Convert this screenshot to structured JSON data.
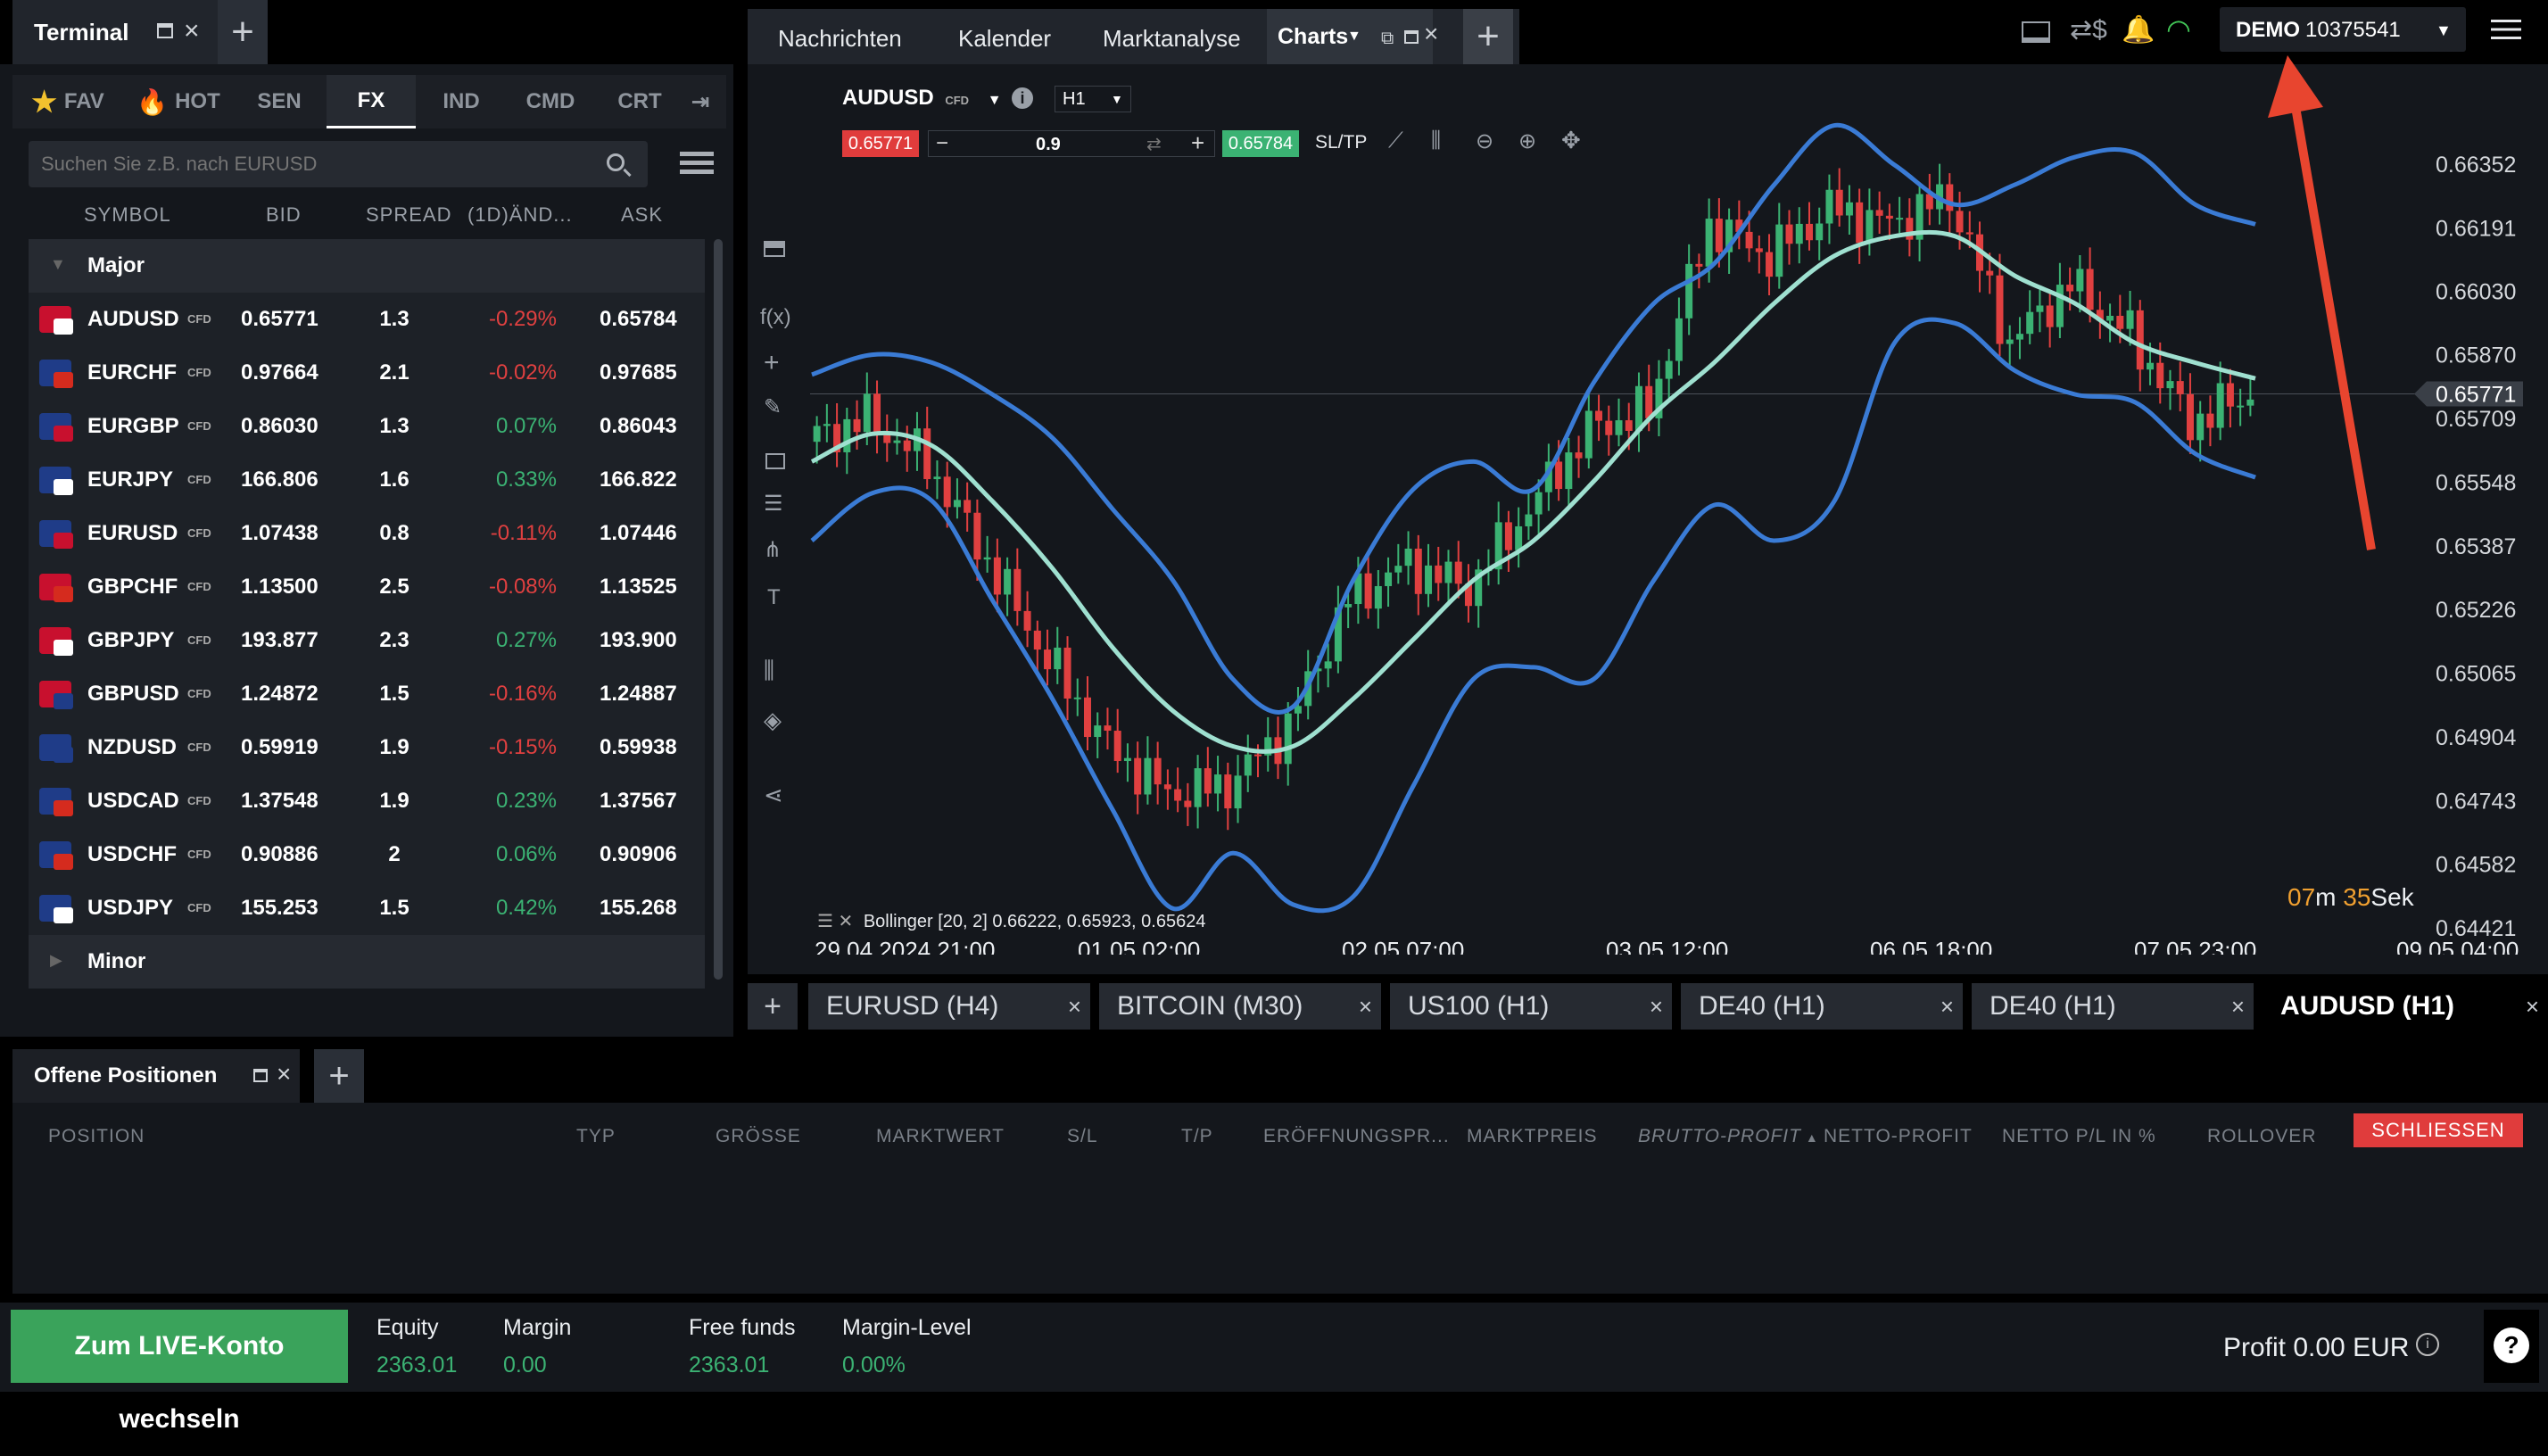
{
  "terminal": {
    "title": "Terminal",
    "search_placeholder": "Suchen Sie z.B. nach EURUSD",
    "categories": [
      "FAV",
      "HOT",
      "SEN",
      "FX",
      "IND",
      "CMD",
      "CRT"
    ],
    "columns": [
      "SYMBOL",
      "BID",
      "SPREAD",
      "(1D)ÄND...",
      "ASK"
    ],
    "group_major": "Major",
    "group_minor": "Minor",
    "cfd": "CFD",
    "rows": [
      {
        "symbol": "AUDUSD",
        "bid": "0.65771",
        "spread": "1.3",
        "change": "-0.29%",
        "ask": "0.65784"
      },
      {
        "symbol": "EURCHF",
        "bid": "0.97664",
        "spread": "2.1",
        "change": "-0.02%",
        "ask": "0.97685"
      },
      {
        "symbol": "EURGBP",
        "bid": "0.86030",
        "spread": "1.3",
        "change": "0.07%",
        "ask": "0.86043"
      },
      {
        "symbol": "EURJPY",
        "bid": "166.806",
        "spread": "1.6",
        "change": "0.33%",
        "ask": "166.822"
      },
      {
        "symbol": "EURUSD",
        "bid": "1.07438",
        "spread": "0.8",
        "change": "-0.11%",
        "ask": "1.07446"
      },
      {
        "symbol": "GBPCHF",
        "bid": "1.13500",
        "spread": "2.5",
        "change": "-0.08%",
        "ask": "1.13525"
      },
      {
        "symbol": "GBPJPY",
        "bid": "193.877",
        "spread": "2.3",
        "change": "0.27%",
        "ask": "193.900"
      },
      {
        "symbol": "GBPUSD",
        "bid": "1.24872",
        "spread": "1.5",
        "change": "-0.16%",
        "ask": "1.24887"
      },
      {
        "symbol": "NZDUSD",
        "bid": "0.59919",
        "spread": "1.9",
        "change": "-0.15%",
        "ask": "0.59938"
      },
      {
        "symbol": "USDCAD",
        "bid": "1.37548",
        "spread": "1.9",
        "change": "0.23%",
        "ask": "1.37567"
      },
      {
        "symbol": "USDCHF",
        "bid": "0.90886",
        "spread": "2",
        "change": "0.06%",
        "ask": "0.90906"
      },
      {
        "symbol": "USDJPY",
        "bid": "155.253",
        "spread": "1.5",
        "change": "0.42%",
        "ask": "155.268"
      }
    ]
  },
  "topnav": {
    "tabs": [
      "Nachrichten",
      "Kalender",
      "Marktanalyse",
      "Charts"
    ],
    "account_mode": "DEMO",
    "account_number": "10375541"
  },
  "chart": {
    "symbol": "AUDUSD",
    "cfd": "CFD",
    "timeframe": "H1",
    "bid": "0.65771",
    "ask": "0.65784",
    "volume": "0.9",
    "sltp": "SL/TP",
    "indicator": "Bollinger [20, 2] 0.66222, 0.65923, 0.65624",
    "countdown_min": "07",
    "countdown_min_unit": "m",
    "countdown_sec": "35",
    "countdown_sec_unit": "Sek"
  },
  "chart_data": {
    "type": "line",
    "title": "AUDUSD H1",
    "y_ticks": [
      "0.66352",
      "0.66191",
      "0.66030",
      "0.65870",
      "0.65709",
      "0.65548",
      "0.65387",
      "0.65226",
      "0.65065",
      "0.64904",
      "0.64743",
      "0.64582",
      "0.64421"
    ],
    "ylim": [
      0.64421,
      0.66352
    ],
    "current_price": "0.65771",
    "x_ticks": [
      "29.04.2024 21:00",
      "01.05 02:00",
      "02.05 07:00",
      "03.05 12:00",
      "06.05 18:00",
      "07.05 23:00",
      "09.05 04:00"
    ],
    "series": [
      {
        "name": "Bollinger upper",
        "values": [
          0.6582,
          0.6587,
          0.6585,
          0.6577,
          0.6566,
          0.6548,
          0.653,
          0.6505,
          0.6498,
          0.653,
          0.6553,
          0.656,
          0.6553,
          0.658,
          0.66,
          0.661,
          0.663,
          0.6645,
          0.6635,
          0.6625,
          0.663,
          0.6637,
          0.6638,
          0.6625,
          0.662
        ]
      },
      {
        "name": "Bollinger middle",
        "values": [
          0.656,
          0.6567,
          0.6564,
          0.655,
          0.6533,
          0.6513,
          0.6497,
          0.6488,
          0.6488,
          0.65,
          0.6515,
          0.653,
          0.654,
          0.6555,
          0.6572,
          0.6585,
          0.66,
          0.6612,
          0.6617,
          0.6617,
          0.6607,
          0.66,
          0.659,
          0.6585,
          0.6581
        ]
      },
      {
        "name": "Bollinger lower",
        "values": [
          0.654,
          0.6552,
          0.655,
          0.6525,
          0.65,
          0.6472,
          0.6447,
          0.6461,
          0.6448,
          0.645,
          0.6478,
          0.6505,
          0.6508,
          0.6505,
          0.653,
          0.6549,
          0.654,
          0.655,
          0.659,
          0.6595,
          0.6583,
          0.6577,
          0.6575,
          0.6562,
          0.6556
        ]
      },
      {
        "name": "Close",
        "values": [
          0.6565,
          0.6571,
          0.656,
          0.6535,
          0.651,
          0.6488,
          0.6476,
          0.6478,
          0.6493,
          0.6525,
          0.6534,
          0.6528,
          0.6548,
          0.6568,
          0.6573,
          0.662,
          0.6612,
          0.6624,
          0.662,
          0.6627,
          0.659,
          0.6605,
          0.6592,
          0.657,
          0.6577
        ]
      }
    ]
  },
  "chart_tabs": [
    "EURUSD (H4)",
    "BITCOIN (M30)",
    "US100 (H1)",
    "DE40 (H1)",
    "DE40 (H1)",
    "AUDUSD (H1)"
  ],
  "positions": {
    "title": "Offene Positionen",
    "columns": [
      "POSITION",
      "TYP",
      "GRÖSSE",
      "MARKTWERT",
      "S/L",
      "T/P",
      "ERÖFFNUNGSPR...",
      "MARKTPREIS",
      "BRUTTO-PROFIT",
      "NETTO-PROFIT",
      "NETTO P/L IN %",
      "ROLLOVER"
    ],
    "close_all": "SCHLIESSEN"
  },
  "footer": {
    "live_button": "Zum LIVE-Konto wechseln",
    "equity_label": "Equity",
    "equity": "2363.01",
    "margin_label": "Margin",
    "margin": "0.00",
    "free_label": "Free funds",
    "free": "2363.01",
    "level_label": "Margin-Level",
    "level": "0.00%",
    "profit": "Profit 0.00 EUR",
    "help": "?"
  },
  "colors": {
    "accent_red": "#e03c3c",
    "positive": "#3bb273",
    "negative": "#e04040",
    "bollinger_outer": "#3a7bd5",
    "bollinger_mid": "#9fe0d0",
    "live_green": "#3aa35b",
    "countdown": "#f0a030"
  }
}
